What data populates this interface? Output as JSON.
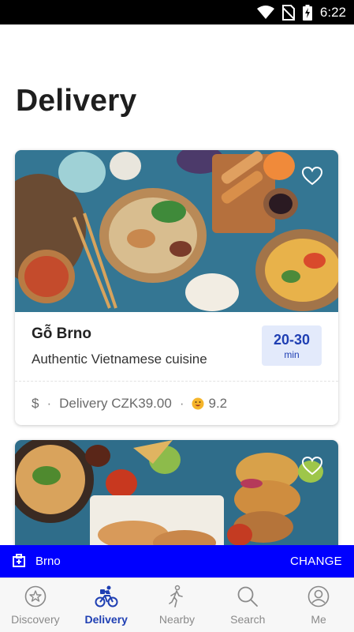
{
  "status_bar": {
    "time": "6:22"
  },
  "page": {
    "title": "Delivery"
  },
  "restaurants": [
    {
      "name": "Gỗ Brno",
      "description": "Authentic Vietnamese cuisine",
      "eta": {
        "time": "20-30",
        "unit": "min"
      },
      "price_level": "$",
      "delivery_fee": "Delivery CZK39.00",
      "rating": "9.2",
      "image_icon": "vietnamese-food-photo"
    },
    {
      "name": "",
      "image_icon": "mexican-food-photo"
    }
  ],
  "location_bar": {
    "city": "Brno",
    "change_label": "CHANGE"
  },
  "nav": {
    "items": [
      {
        "label": "Discovery",
        "icon": "star-circle-icon"
      },
      {
        "label": "Delivery",
        "icon": "cyclist-icon",
        "active": true
      },
      {
        "label": "Nearby",
        "icon": "walker-icon"
      },
      {
        "label": "Search",
        "icon": "search-icon"
      },
      {
        "label": "Me",
        "icon": "profile-icon"
      }
    ]
  },
  "colors": {
    "brand_blue": "#0000ff",
    "accent_blue": "#1f3fb3",
    "badge_bg": "#e3eafb"
  }
}
